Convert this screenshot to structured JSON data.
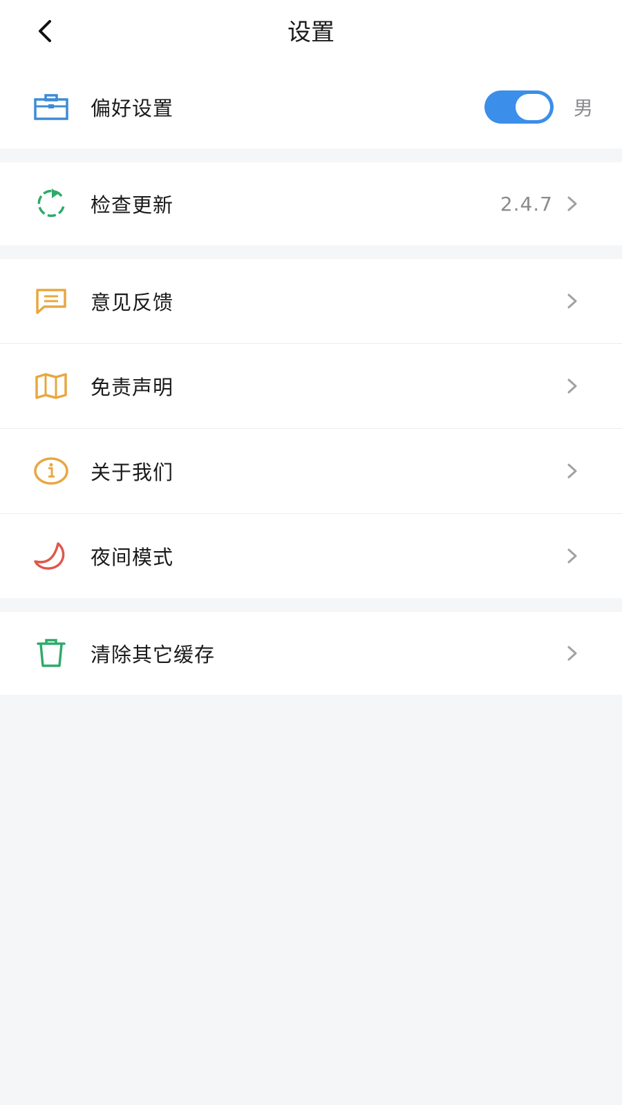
{
  "header": {
    "title": "设置"
  },
  "preferences": {
    "label": "偏好设置",
    "toggle_on": true,
    "toggle_text": "男"
  },
  "update": {
    "label": "检查更新",
    "version": "2.4.7"
  },
  "menu": {
    "feedback": "意见反馈",
    "disclaimer": "免责声明",
    "about": "关于我们",
    "night_mode": "夜间模式"
  },
  "cache": {
    "label": "清除其它缓存"
  },
  "colors": {
    "accent_blue": "#3b8eea",
    "icon_blue": "#3d8bd6",
    "icon_green": "#2eaa6a",
    "icon_orange": "#e8a740",
    "icon_red": "#e0574a",
    "chevron_gray": "#a0a0a5"
  },
  "icons": {
    "back": "chevron-left-icon",
    "preferences": "briefcase-icon",
    "update": "refresh-icon",
    "feedback": "message-icon",
    "disclaimer": "map-icon",
    "about": "info-icon",
    "night_mode": "moon-icon",
    "cache": "trash-icon",
    "row_arrow": "chevron-right-icon"
  }
}
